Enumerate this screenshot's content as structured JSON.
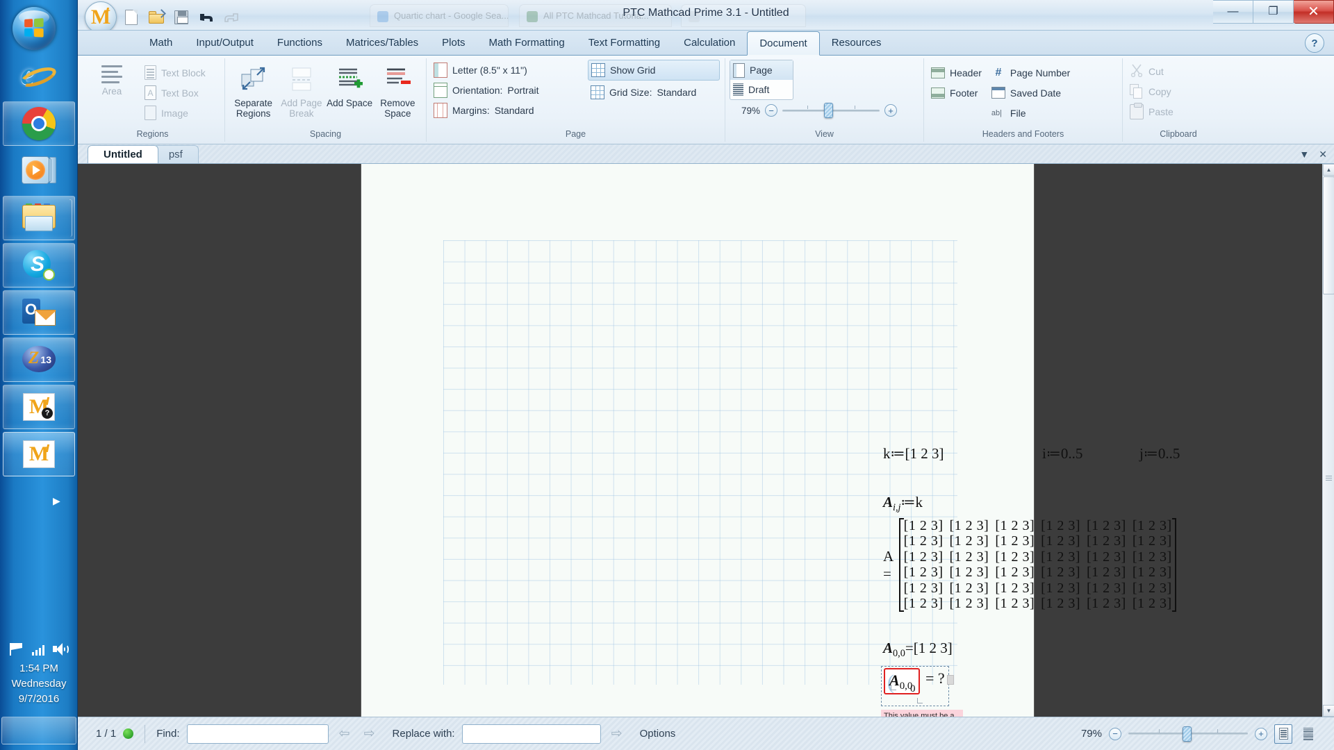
{
  "taskbar": {
    "start_label": "Start",
    "items": [
      {
        "name": "internet-explorer",
        "label": "Internet Explorer"
      },
      {
        "name": "google-chrome",
        "label": "Google Chrome"
      },
      {
        "name": "windows-media-player",
        "label": "Windows Media Player"
      },
      {
        "name": "file-explorer",
        "label": "File Explorer"
      },
      {
        "name": "skype",
        "label": "Skype"
      },
      {
        "name": "outlook",
        "label": "Microsoft Outlook"
      },
      {
        "name": "zoiper",
        "label": "Zoiper",
        "badge": "13"
      },
      {
        "name": "mathcad-help",
        "label": "PTC Mathcad Help"
      },
      {
        "name": "mathcad",
        "label": "PTC Mathcad Prime"
      }
    ],
    "clock": {
      "time": "1:54 PM",
      "day": "Wednesday",
      "date": "9/7/2016"
    }
  },
  "window": {
    "title": "PTC Mathcad Prime 3.1 - Untitled",
    "minimize": "—",
    "restore": "❐",
    "close": "✕"
  },
  "ghost_tabs": [
    {
      "label": "Quartic chart - Google Sea..."
    },
    {
      "label": "All PTC Mathcad Tutoria..."
    }
  ],
  "quick_access": [
    {
      "name": "new-document",
      "label": "New"
    },
    {
      "name": "open-document",
      "label": "Open"
    },
    {
      "name": "save-document",
      "label": "Save"
    },
    {
      "name": "undo",
      "label": "Undo"
    },
    {
      "name": "redo",
      "label": "Redo"
    }
  ],
  "ribbon": {
    "tabs": [
      {
        "label": "Math",
        "active": false
      },
      {
        "label": "Input/Output",
        "active": false
      },
      {
        "label": "Functions",
        "active": false
      },
      {
        "label": "Matrices/Tables",
        "active": false
      },
      {
        "label": "Plots",
        "active": false
      },
      {
        "label": "Math Formatting",
        "active": false
      },
      {
        "label": "Text Formatting",
        "active": false
      },
      {
        "label": "Calculation",
        "active": false
      },
      {
        "label": "Document",
        "active": true
      },
      {
        "label": "Resources",
        "active": false
      }
    ],
    "help_glyph": "?",
    "groups": {
      "regions": {
        "title": "Regions",
        "area_label": "Area",
        "items": [
          {
            "label": "Text Block",
            "disabled": true
          },
          {
            "label": "Text Box",
            "disabled": true
          },
          {
            "label": "Image",
            "disabled": true
          }
        ]
      },
      "spacing": {
        "title": "Spacing",
        "buttons": [
          {
            "label": "Separate Regions",
            "disabled": false,
            "has_menu": true
          },
          {
            "label": "Add Page Break",
            "disabled": true,
            "has_menu": false
          },
          {
            "label": "Add Space",
            "disabled": false,
            "has_menu": true
          },
          {
            "label": "Remove Space",
            "disabled": false,
            "has_menu": true
          }
        ]
      },
      "page": {
        "title": "Page",
        "rows": [
          {
            "label": "Letter (8.5\" x 11\")",
            "value": "",
            "has_menu": true
          },
          {
            "label": "Orientation:",
            "value": "Portrait",
            "has_menu": true
          },
          {
            "label": "Margins:",
            "value": "Standard",
            "has_menu": true
          }
        ],
        "toggles": [
          {
            "label": "Show Grid",
            "pressed": true
          },
          {
            "label": "Grid Size:",
            "value": "Standard",
            "has_menu": true
          }
        ]
      },
      "view": {
        "title": "View",
        "modes": [
          {
            "label": "Page",
            "selected": true
          },
          {
            "label": "Draft",
            "selected": false
          }
        ],
        "zoom_percent": "79%",
        "zoom_out": "−",
        "zoom_in": "+"
      },
      "headers_footers": {
        "title": "Headers and Footers",
        "left": [
          {
            "label": "Header"
          },
          {
            "label": "Footer"
          }
        ],
        "right": [
          {
            "label": "Page Number",
            "has_menu": true
          },
          {
            "label": "Saved Date",
            "has_menu": true
          },
          {
            "label": "File",
            "has_menu": true
          }
        ]
      },
      "clipboard": {
        "title": "Clipboard",
        "items": [
          {
            "label": "Cut",
            "disabled": true
          },
          {
            "label": "Copy",
            "disabled": true
          },
          {
            "label": "Paste",
            "disabled": true
          }
        ]
      }
    }
  },
  "worksheet_tabs": [
    {
      "label": "Untitled",
      "active": true
    },
    {
      "label": "psf",
      "active": false
    }
  ],
  "worksheet": {
    "expressions": {
      "k_def": "k≔[1  2  3]",
      "i_def": "i≔0..5",
      "j_def": "j≔0..5",
      "a_assign_name": "A",
      "a_assign_sub": "i,j",
      "a_assign_rhs": "≔k",
      "matrix_label": "A =",
      "matrix_rows": [
        [
          "[1 2 3]",
          "[1 2 3]",
          "[1 2 3]",
          "[1 2 3]",
          "[1 2 3]",
          "[1 2 3]"
        ],
        [
          "[1 2 3]",
          "[1 2 3]",
          "[1 2 3]",
          "[1 2 3]",
          "[1 2 3]",
          "[1 2 3]"
        ],
        [
          "[1 2 3]",
          "[1 2 3]",
          "[1 2 3]",
          "[1 2 3]",
          "[1 2 3]",
          "[1 2 3]"
        ],
        [
          "[1 2 3]",
          "[1 2 3]",
          "[1 2 3]",
          "[1 2 3]",
          "[1 2 3]",
          "[1 2 3]"
        ],
        [
          "[1 2 3]",
          "[1 2 3]",
          "[1 2 3]",
          "[1 2 3]",
          "[1 2 3]",
          "[1 2 3]"
        ],
        [
          "[1 2 3]",
          "[1 2 3]",
          "[1 2 3]",
          "[1 2 3]",
          "[1 2 3]",
          "[1 2 3]"
        ]
      ],
      "a00_eval_name": "A",
      "a00_eval_sub": "0,0",
      "a00_eval_rhs": "=[1  2  3]",
      "error_expr_name": "A",
      "error_expr_sub": "0,0",
      "error_eq": "= ?",
      "error_sub_outer": "0",
      "error_message": "This value must be a vector."
    }
  },
  "statusbar": {
    "page_indicator": "1 / 1",
    "find_label": "Find:",
    "find_value": "",
    "find_placeholder": "",
    "replace_label": "Replace with:",
    "replace_value": "",
    "replace_placeholder": "",
    "options_label": "Options",
    "zoom_percent": "79%",
    "zoom_out": "−",
    "zoom_in": "+",
    "prev_arrow": "⇦",
    "next_arrow": "⇨"
  },
  "colors": {
    "accent": "#2a6090",
    "error_border": "#e02020",
    "error_bg": "#fbd4dc",
    "ready_dot": "#138a1a",
    "brand_orange": "#f0a41a"
  }
}
